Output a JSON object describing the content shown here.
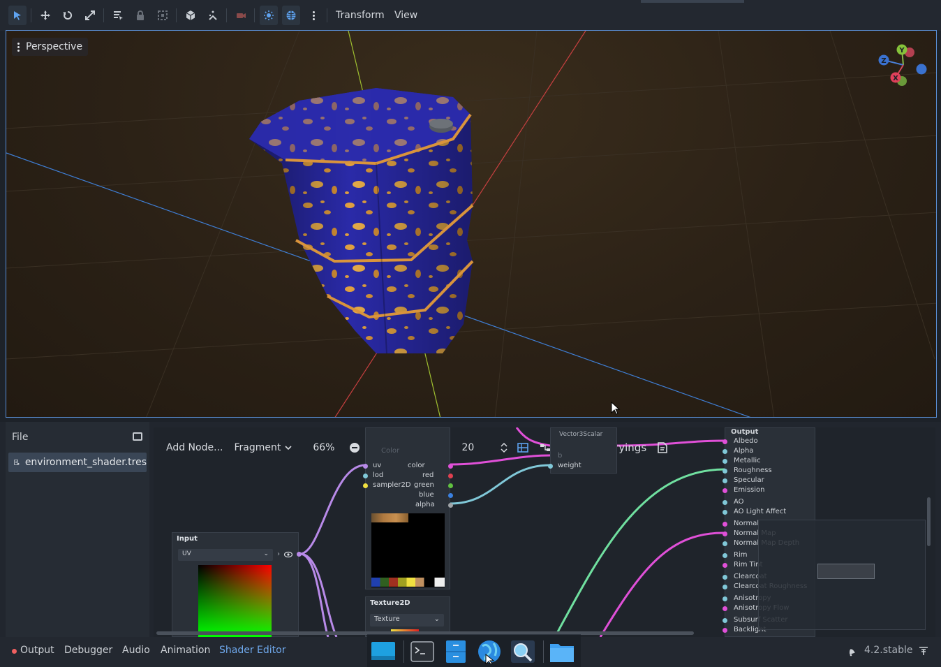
{
  "toolbar": {
    "menus": [
      "Transform",
      "View"
    ]
  },
  "viewport": {
    "view_mode": "Perspective",
    "gizmo_axes": [
      "Y",
      "Z",
      "X"
    ]
  },
  "file_panel": {
    "title": "File",
    "items": [
      "environment_shader.tres"
    ]
  },
  "graph_toolbar": {
    "add_node": "Add Node...",
    "shader_mode": "Fragment",
    "zoom": "66%",
    "snap_value": "20",
    "manage_varyings": "Manage Varyings"
  },
  "nodes": {
    "input": {
      "title": "Input",
      "select": "UV"
    },
    "texture": {
      "ports_in": [
        "uv",
        "lod",
        "sampler2D"
      ],
      "ports_out": [
        "color",
        "red",
        "green",
        "blue",
        "alpha"
      ],
      "hidden_label": "Color"
    },
    "texture2d": {
      "title": "Texture2D",
      "select": "Texture"
    },
    "vector3scalar": {
      "title": "Vector3Scalar",
      "ports": [
        "b",
        "weight"
      ]
    },
    "output": {
      "title": "Output",
      "ports": [
        "Albedo",
        "Alpha",
        "Metallic",
        "Roughness",
        "Specular",
        "Emission",
        "AO",
        "AO Light Affect",
        "Normal",
        "Normal Map",
        "Normal Map Depth",
        "Rim",
        "Rim Tint",
        "Clearcoat",
        "Clearcoat Roughness",
        "Anisotropy",
        "Anisotropy Flow",
        "Subsurf Scatter",
        "Backlight"
      ]
    }
  },
  "bottom_tabs": [
    "Output",
    "Debugger",
    "Audio",
    "Animation",
    "Shader Editor"
  ],
  "active_bottom_tab": "Shader Editor",
  "version": "4.2.stable",
  "colors": {
    "accent": "#5a8fd6",
    "active_tab": "#6fa8ec",
    "barrel_blue": "#2a2aa8",
    "rust": "#e0a040"
  }
}
